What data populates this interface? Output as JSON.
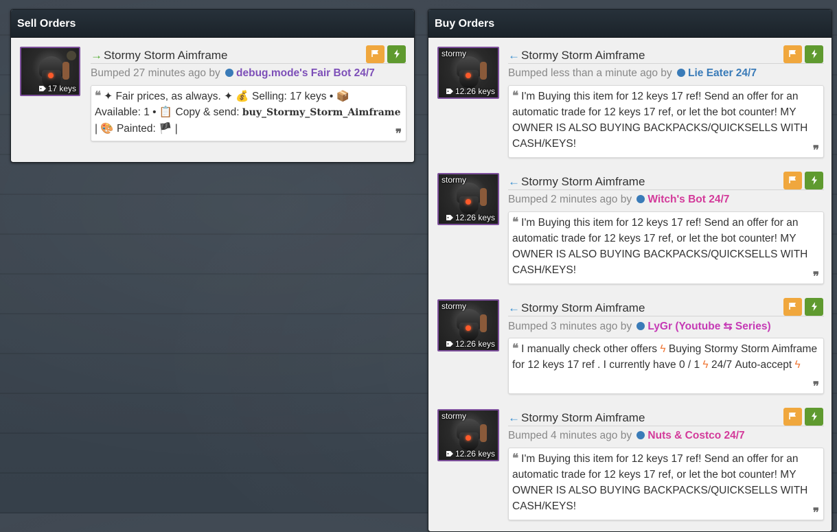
{
  "sell_panel": {
    "title": "Sell Orders",
    "listings": [
      {
        "item_name": "Stormy Storm Aimframe",
        "thumb_label": "",
        "price": "17 keys",
        "bumped_prefix": "Bumped 27 minutes ago by",
        "user": "debug.mode's Fair Bot 24/7",
        "user_color": "#7d4fb8",
        "details": {
          "part1": "✦ Fair prices, as always. ✦ 💰 Selling: 17 keys • 📦",
          "part2": "Available: 1 • 📋 Copy & send:",
          "command": "buy_Stormy_Storm_Aimframe",
          "part3": "| 🎨 Painted: 🏴 |"
        }
      }
    ]
  },
  "buy_panel": {
    "title": "Buy Orders",
    "listings": [
      {
        "item_name": "Stormy Storm Aimframe",
        "thumb_label": "stormy",
        "price": "12.26 keys",
        "bumped_prefix": "Bumped less than a minute ago by",
        "user": "Lie Eater 24/7",
        "user_color": "#3a7bb8",
        "details": "I'm Buying this item for 12 keys 17 ref! Send an offer for an automatic trade for 12 keys 17 ref, or let the bot counter! MY OWNER IS ALSO BUYING BACKPACKS/QUICKSELLS WITH CASH/KEYS!"
      },
      {
        "item_name": "Stormy Storm Aimframe",
        "thumb_label": "stormy",
        "price": "12.26 keys",
        "bumped_prefix": "Bumped 2 minutes ago by",
        "user": "Witch's Bot 24/7",
        "user_color": "#d33a9a",
        "details": "I'm Buying this item for 12 keys 17 ref! Send an offer for an automatic trade for 12 keys 17 ref, or let the bot counter! MY OWNER IS ALSO BUYING BACKPACKS/QUICKSELLS WITH CASH/KEYS!"
      },
      {
        "item_name": "Stormy Storm Aimframe",
        "thumb_label": "stormy",
        "price": "12.26 keys",
        "bumped_prefix": "Bumped 3 minutes ago by",
        "user": "LyGr (Youtube ⇆ Series)",
        "user_color": "#c53ab5",
        "details_parts": {
          "a": "I manually check other offers",
          "b": "Buying Stormy Storm Aimframe for 12 keys 17 ref . I currently have 0 / 1",
          "c": "24/7 Auto-accept"
        }
      },
      {
        "item_name": "Stormy Storm Aimframe",
        "thumb_label": "stormy",
        "price": "12.26 keys",
        "bumped_prefix": "Bumped 4 minutes ago by",
        "user": "Nuts & Costco 24/7",
        "user_color": "#d33a9a",
        "details": "I'm Buying this item for 12 keys 17 ref! Send an offer for an automatic trade for 12 keys 17 ref, or let the bot counter! MY OWNER IS ALSO BUYING BACKPACKS/QUICKSELLS WITH CASH/KEYS!"
      }
    ]
  },
  "icons": {
    "sell_arrow": "arrow-right-icon",
    "buy_arrow": "arrow-left-icon",
    "flag": "flag-icon",
    "bolt": "bolt-icon",
    "quote": "quote-icon",
    "tag": "tag-icon"
  },
  "colors": {
    "sell_arrow": "#4caa2a",
    "buy_arrow": "#3a8fd0",
    "flag_button": "#f0a73d",
    "bolt_button": "#5f9a2f",
    "item_border": "#7d4f9c"
  }
}
